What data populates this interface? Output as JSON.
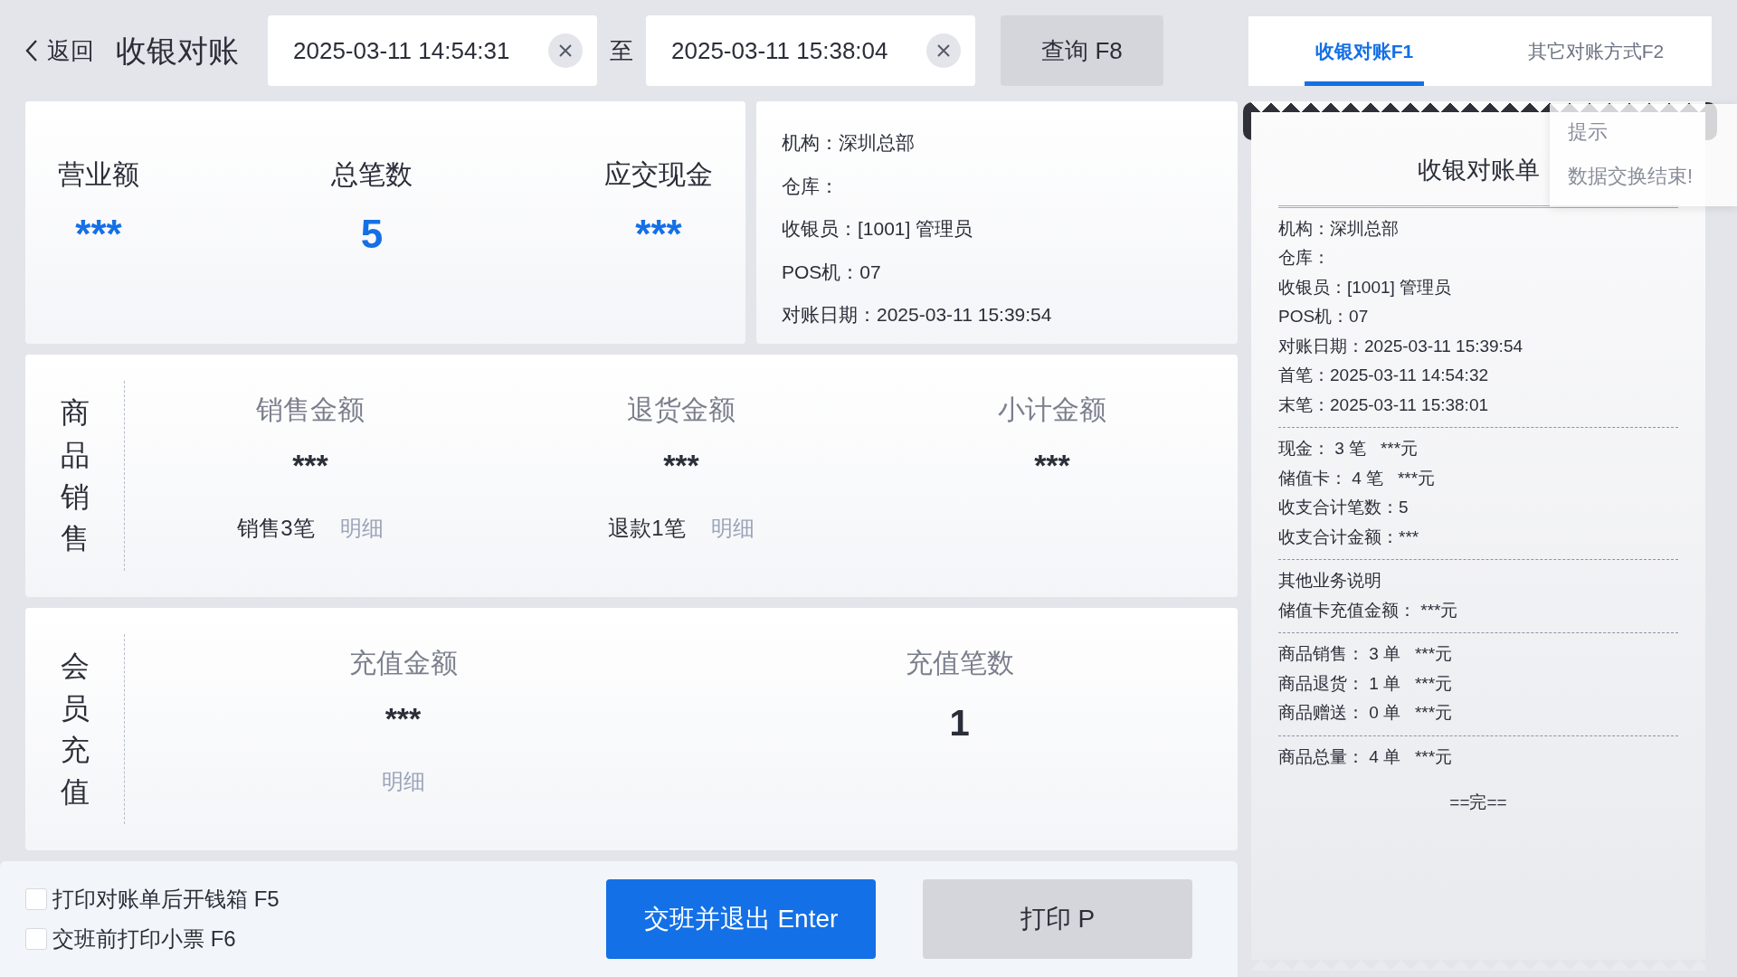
{
  "header": {
    "back": "返回",
    "title": "收银对账",
    "start_time": "2025-03-11 14:54:31",
    "separator": "至",
    "end_time": "2025-03-11 15:38:04",
    "query_button": "查询 F8"
  },
  "tabs": [
    {
      "label": "收银对账F1",
      "selected": true
    },
    {
      "label": "其它对账方式F2",
      "selected": false
    }
  ],
  "summary": [
    {
      "label": "营业额",
      "value": "***"
    },
    {
      "label": "总笔数",
      "value": "5"
    },
    {
      "label": "应交现金",
      "value": "***"
    }
  ],
  "info": [
    "机构：深圳总部",
    "仓库：",
    "收银员：[1001] 管理员",
    "POS机：07",
    "对账日期：2025-03-11 15:39:54"
  ],
  "sections": [
    {
      "title": "商品销售",
      "columns": [
        {
          "label": "销售金额",
          "value": "***",
          "count": "销售3笔",
          "link": "明细"
        },
        {
          "label": "退货金额",
          "value": "***",
          "count": "退款1笔",
          "link": "明细"
        },
        {
          "label": "小计金额",
          "value": "***"
        }
      ]
    },
    {
      "title": "会员充值",
      "columns": [
        {
          "label": "充值金额",
          "value": "***",
          "link": "明细"
        },
        {
          "label": "充值笔数",
          "value": "1"
        }
      ]
    }
  ],
  "options": [
    {
      "label": "打印对账单后开钱箱 F5",
      "checked": false
    },
    {
      "label": "交班前打印小票 F6",
      "checked": false
    }
  ],
  "buttons": [
    {
      "label": "交班并退出 Enter",
      "kind": "primary"
    },
    {
      "label": "打印 P",
      "kind": "secondary"
    }
  ],
  "receipt": {
    "title": "收银对账单",
    "groups": [
      [
        "机构：深圳总部",
        "仓库：",
        "收银员：[1001] 管理员",
        "POS机：07",
        "对账日期：2025-03-11 15:39:54",
        "首笔：2025-03-11 14:54:32",
        "末笔：2025-03-11 15:38:01"
      ],
      [
        "现金： 3 笔   ***元",
        "储值卡： 4 笔   ***元",
        "收支合计笔数：5",
        "收支合计金额：***"
      ],
      [
        "其他业务说明",
        "储值卡充值金额： ***元"
      ],
      [
        "商品销售： 3 单   ***元",
        "商品退货： 1 单   ***元",
        "商品赠送： 0 单   ***元"
      ],
      [
        "商品总量： 4 单   ***元"
      ]
    ],
    "end": "==完=="
  },
  "toast": {
    "title": "提示",
    "message": "数据交换结束!"
  }
}
